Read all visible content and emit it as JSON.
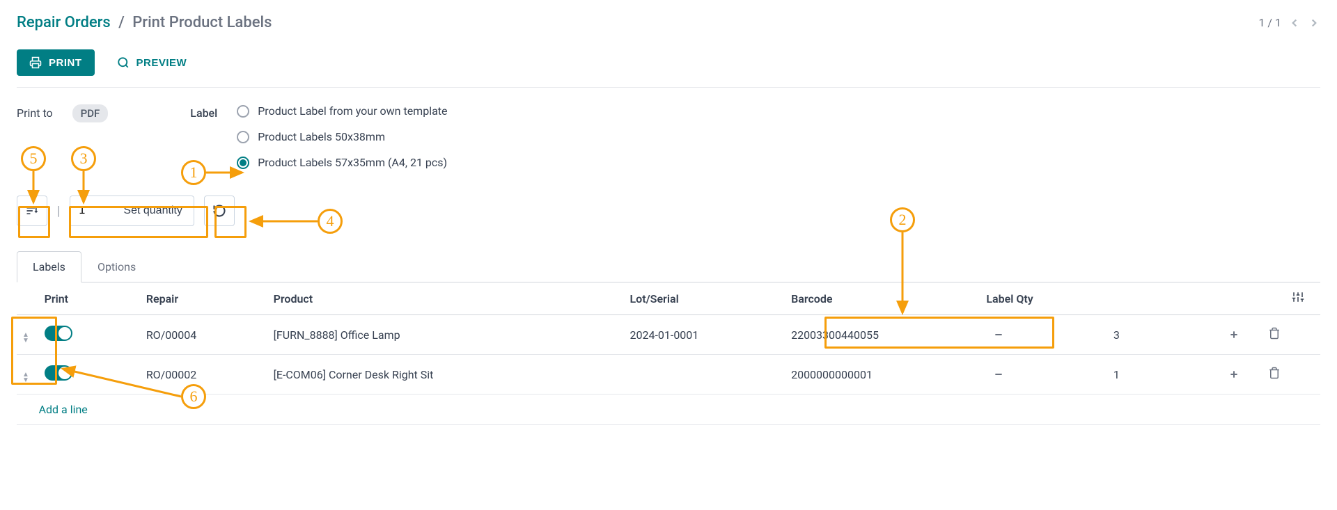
{
  "breadcrumb": {
    "root": "Repair Orders",
    "current": "Print Product Labels"
  },
  "pager": {
    "text": "1 / 1"
  },
  "actions": {
    "print": "PRINT",
    "preview": "PREVIEW"
  },
  "form": {
    "print_to_label": "Print to",
    "print_to_value": "PDF",
    "label_label": "Label",
    "radio_options": [
      {
        "label": "Product Label from your own template",
        "checked": false
      },
      {
        "label": "Product Labels 50x38mm",
        "checked": false
      },
      {
        "label": "Product Labels 57x35mm (A4, 21 pcs)",
        "checked": true
      }
    ],
    "qty_input": "1",
    "set_qty_btn": "Set quantity"
  },
  "tabs": {
    "labels": "Labels",
    "options": "Options"
  },
  "table": {
    "headers": {
      "print": "Print",
      "repair": "Repair",
      "product": "Product",
      "lot": "Lot/Serial",
      "barcode": "Barcode",
      "label_qty": "Label Qty"
    },
    "rows": [
      {
        "print": true,
        "repair": "RO/00004",
        "product": "[FURN_8888] Office Lamp",
        "lot": "2024-01-0001",
        "barcode": "22003300440055",
        "qty": "3"
      },
      {
        "print": true,
        "repair": "RO/00002",
        "product": "[E-COM06] Corner Desk Right Sit",
        "lot": "",
        "barcode": "2000000000001",
        "qty": "1"
      }
    ],
    "add_line": "Add a line"
  },
  "annotations": {
    "callouts": [
      "1",
      "2",
      "3",
      "4",
      "5",
      "6"
    ]
  }
}
